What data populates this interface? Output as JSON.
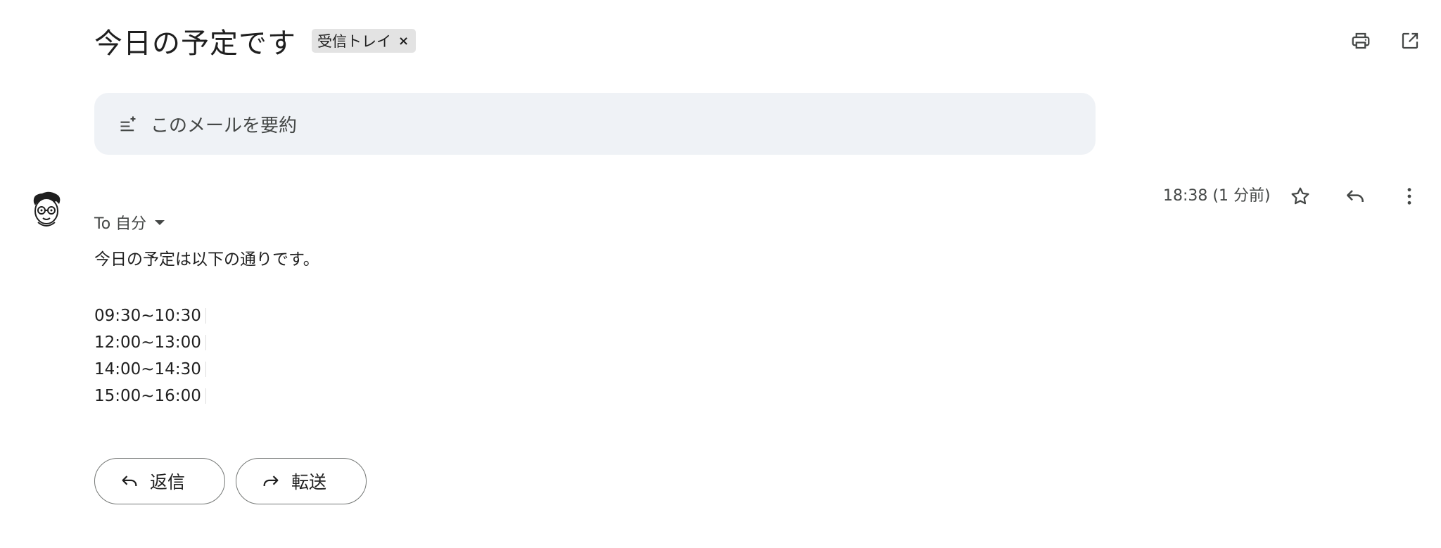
{
  "header": {
    "subject": "今日の予定です",
    "label_chip": "受信トレイ",
    "label_remove": "×"
  },
  "summary": {
    "label": "このメールを要約"
  },
  "message": {
    "recipient": "To 自分",
    "timestamp": "18:38 (1 分前)",
    "intro": "今日の予定は以下の通りです。",
    "schedule": [
      {
        "time": "09:30~10:30"
      },
      {
        "time": "12:00~13:00"
      },
      {
        "time": "14:00~14:30"
      },
      {
        "time": "15:00~16:00"
      }
    ]
  },
  "actions": {
    "reply_label": "返信",
    "forward_label": "転送"
  },
  "icons": {
    "print": "print-icon",
    "popout": "open-in-new-window-icon",
    "summarize": "summarize-icon",
    "star": "star-icon",
    "reply": "reply-icon",
    "more": "more-vert-icon",
    "forward": "forward-icon"
  }
}
